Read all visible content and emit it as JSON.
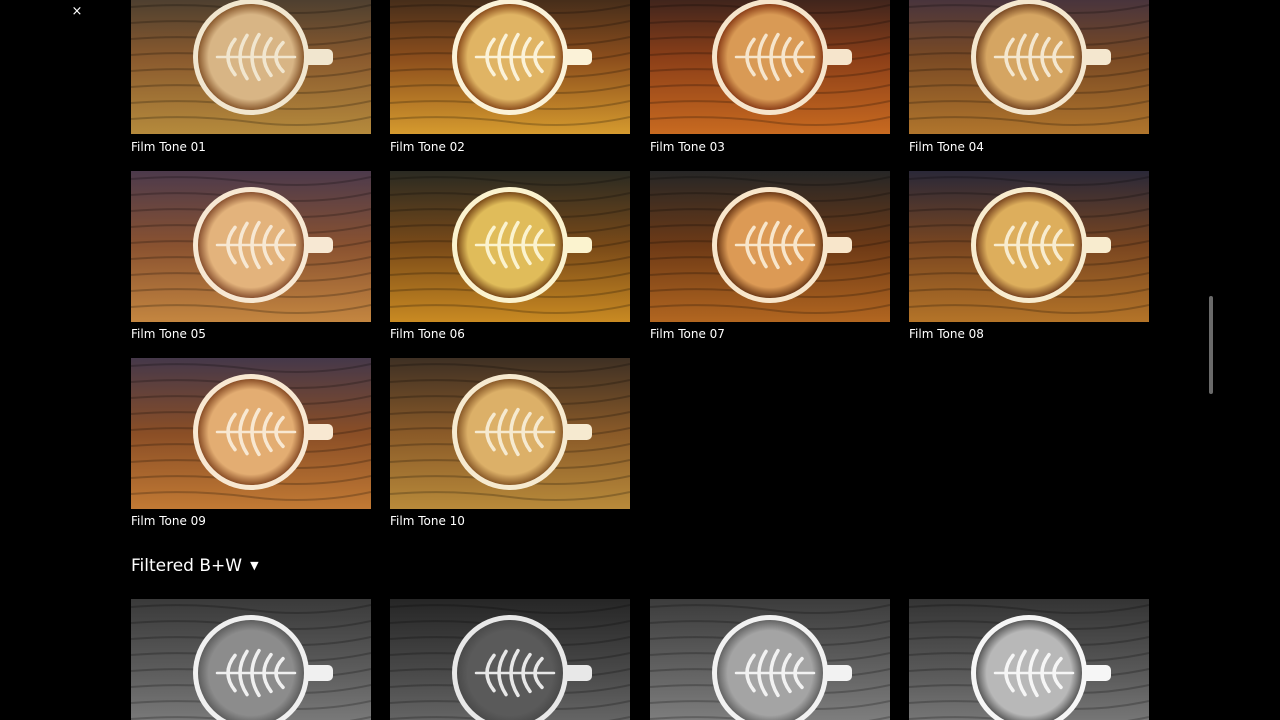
{
  "close_label": "×",
  "film_tones": {
    "tiles": [
      {
        "label": "Film Tone 01",
        "palette": {
          "top": "#3d3830",
          "mid": "#8a5a2e",
          "bot": "#b58a3c",
          "foam": "#d8b585",
          "crema": "#f1e6cf"
        }
      },
      {
        "label": "Film Tone 02",
        "palette": {
          "top": "#32241a",
          "mid": "#8c4e1c",
          "bot": "#d59a2e",
          "foam": "#e0b464",
          "crema": "#fbf2d8"
        }
      },
      {
        "label": "Film Tone 03",
        "palette": {
          "top": "#2a1d1e",
          "mid": "#8c3f18",
          "bot": "#c86a20",
          "foam": "#d99a55",
          "crema": "#f6e5cc"
        }
      },
      {
        "label": "Film Tone 04",
        "palette": {
          "top": "#3a2e44",
          "mid": "#7a4a24",
          "bot": "#b0752c",
          "foam": "#d5a562",
          "crema": "#f4e7cf"
        }
      },
      {
        "label": "Film Tone 05",
        "palette": {
          "top": "#4c3a4c",
          "mid": "#8a5230",
          "bot": "#c48640",
          "foam": "#e3b37c",
          "crema": "#f7e8d3"
        }
      },
      {
        "label": "Film Tone 06",
        "palette": {
          "top": "#2a2a22",
          "mid": "#7a4a18",
          "bot": "#c98a22",
          "foam": "#e0bc5a",
          "crema": "#fbf3cf"
        }
      },
      {
        "label": "Film Tone 07",
        "palette": {
          "top": "#262626",
          "mid": "#6e3a16",
          "bot": "#b26620",
          "foam": "#dc9a55",
          "crema": "#f8e6cb"
        }
      },
      {
        "label": "Film Tone 08",
        "palette": {
          "top": "#2a2838",
          "mid": "#7a4620",
          "bot": "#b47428",
          "foam": "#ddae5c",
          "crema": "#f8eccf"
        }
      },
      {
        "label": "Film Tone 09",
        "palette": {
          "top": "#45384a",
          "mid": "#8a4e26",
          "bot": "#c27a34",
          "foam": "#e3ad72",
          "crema": "#f8e8d2"
        }
      },
      {
        "label": "Film Tone 10",
        "palette": {
          "top": "#3e3024",
          "mid": "#8a5a28",
          "bot": "#b88a3a",
          "foam": "#dcb068",
          "crema": "#f6ead0"
        }
      }
    ]
  },
  "filtered_bw": {
    "heading": "Filtered B+W",
    "caret": "▼",
    "tiles": [
      {
        "palette": {
          "top": "#3a3a3a",
          "mid": "#5e5e5e",
          "bot": "#8a8a8a",
          "foam": "#8c8c8c",
          "crema": "#f0f0f0"
        }
      },
      {
        "palette": {
          "top": "#262626",
          "mid": "#4a4a4a",
          "bot": "#767676",
          "foam": "#5a5a5a",
          "crema": "#e8e8e8"
        }
      },
      {
        "palette": {
          "top": "#3c3c3c",
          "mid": "#646464",
          "bot": "#8e8e8e",
          "foam": "#a4a4a4",
          "crema": "#f2f2f2"
        }
      },
      {
        "palette": {
          "top": "#343434",
          "mid": "#5a5a5a",
          "bot": "#888888",
          "foam": "#b8b8b8",
          "crema": "#f6f6f6"
        }
      }
    ]
  }
}
